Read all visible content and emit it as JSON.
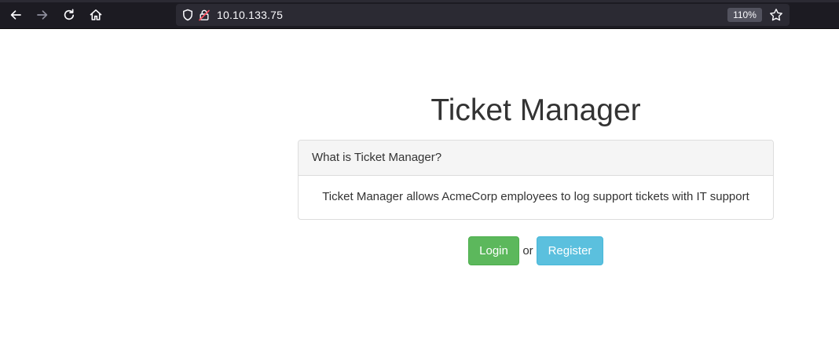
{
  "browser": {
    "address": "10.10.133.75",
    "zoom": "110%",
    "icons": {
      "back": "back-arrow-icon",
      "forward": "forward-arrow-icon",
      "reload": "reload-icon",
      "home": "home-icon",
      "tracking": "shield-icon",
      "security": "insecure-lock-icon",
      "bookmark": "star-icon"
    }
  },
  "page": {
    "title": "Ticket Manager",
    "panel": {
      "heading": "What is Ticket Manager?",
      "body": "Ticket Manager allows AcmeCorp employees to log support tickets with IT support"
    },
    "actions": {
      "login_label": "Login",
      "separator": "or",
      "register_label": "Register"
    }
  },
  "colors": {
    "login_button": "#5cb85c",
    "register_button": "#5bc0de",
    "toolbar_bg": "#1c1b22",
    "text": "#333333"
  }
}
